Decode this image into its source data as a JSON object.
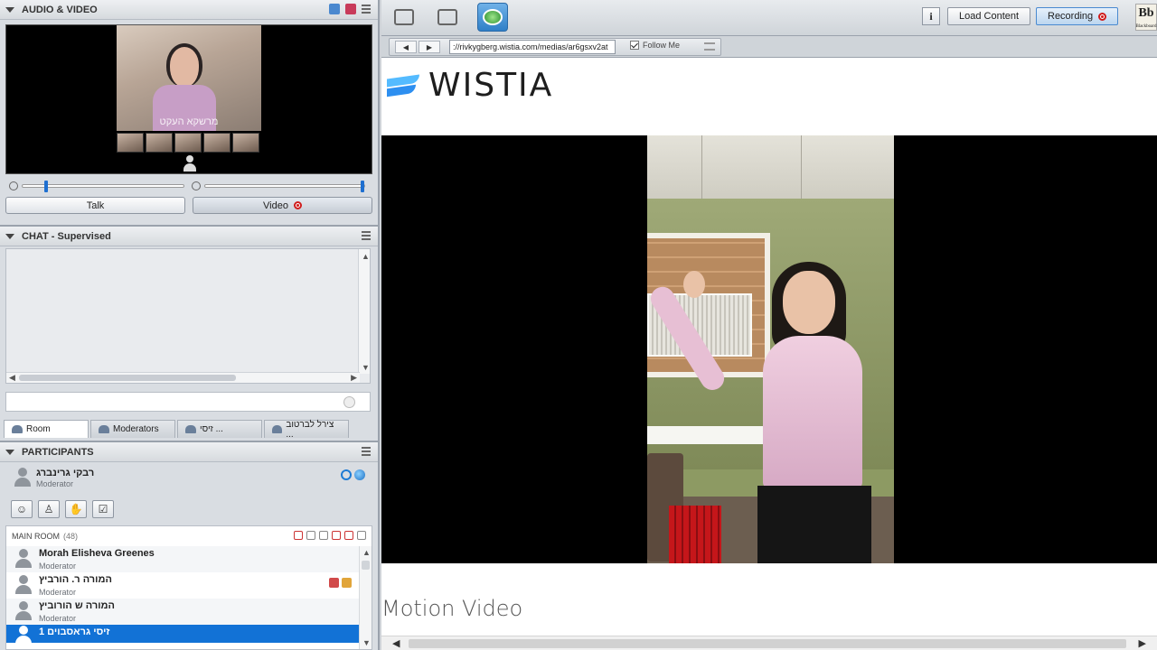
{
  "audio_video": {
    "title": "AUDIO & VIDEO",
    "main_caption": "מרשקא העקט",
    "talk_label": "Talk",
    "video_label": "Video"
  },
  "chat": {
    "title": "CHAT - Supervised",
    "tabs": [
      {
        "label": "Room"
      },
      {
        "label": "Moderators"
      },
      {
        "label": "זיסי ..."
      },
      {
        "label": "צירל לברטוב ..."
      }
    ]
  },
  "participants": {
    "title": "PARTICIPANTS",
    "me": {
      "name": "רבקי גרינברג",
      "role": "Moderator"
    },
    "main_room_label": "MAIN ROOM",
    "main_room_count": "(48)",
    "list": [
      {
        "name": "Morah Elisheva Greenes",
        "role": "Moderator"
      },
      {
        "name": "המורה ר. הורביץ",
        "role": "Moderator"
      },
      {
        "name": "המורה ש הורוביץ",
        "role": "Moderator"
      },
      {
        "name": "זיסי גראסבוים 1",
        "role": ""
      }
    ]
  },
  "toolbar": {
    "info_label": "i",
    "load_content_label": "Load Content",
    "recording_label": "Recording",
    "logo_text": "Bb",
    "logo_sub": "Blackboard"
  },
  "browser": {
    "url": "://rivkygberg.wistia.com/medias/ar6gsxv2at",
    "follow_me_label": "Follow Me",
    "brand": "WISTIA",
    "video_title": "Motion Video"
  },
  "colors": {
    "accent": "#1272d6",
    "recording": "#d01c1c",
    "wistia_blue": "#54bbff"
  }
}
